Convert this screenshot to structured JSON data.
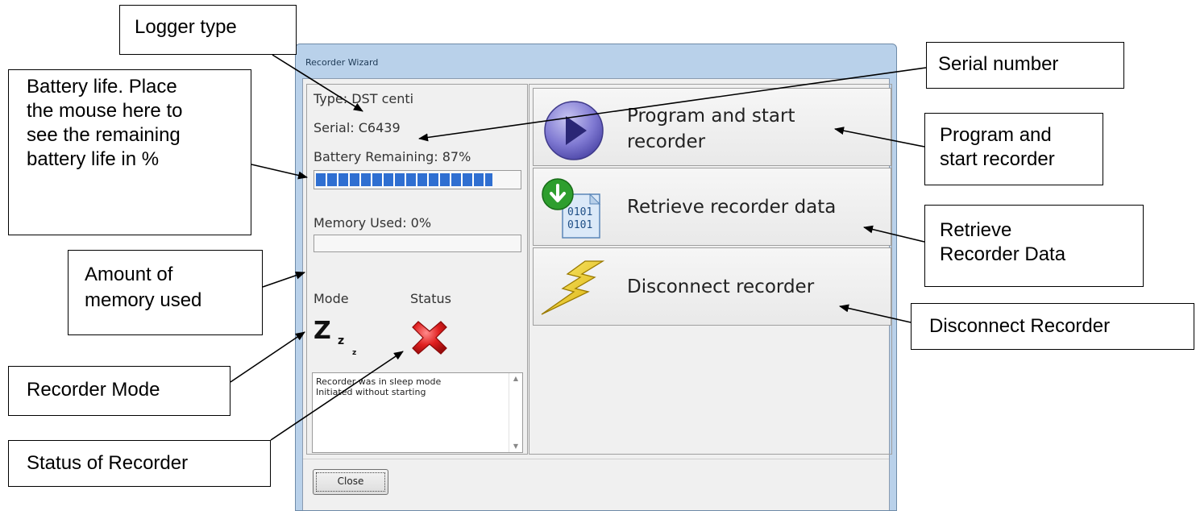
{
  "window": {
    "title": "Recorder Wizard",
    "close_button_label": "Close"
  },
  "info": {
    "type_text": "Type: DST centi",
    "serial_text": "Serial: C6439",
    "battery_text": "Battery Remaining: 87%",
    "battery_fraction": 0.87,
    "memory_text": "Memory Used: 0%",
    "memory_fraction": 0.0,
    "mode_label": "Mode",
    "status_label": "Status",
    "mode_icon": "sleep-zzz-icon",
    "status_icon": "red-x-icon"
  },
  "log": {
    "lines": [
      "Recorder was in sleep mode",
      "Initiated without starting"
    ]
  },
  "actions": {
    "program_label_1": "Program and start",
    "program_label_2": "recorder",
    "retrieve_label": "Retrieve recorder data",
    "disconnect_label": "Disconnect recorder",
    "retrieve_icon_text_1": "0101",
    "retrieve_icon_text_2": "0101"
  },
  "callouts": {
    "logger_type": "Logger type",
    "serial_number": "Serial number",
    "battery_1": "Battery life. Place",
    "battery_2": "the mouse here to",
    "battery_3": "see the remaining",
    "battery_4": "battery life in %",
    "program_1": "Program and",
    "program_2": "start recorder",
    "memory_1": "Amount of",
    "memory_2": "memory used",
    "retrieve_1": "Retrieve",
    "retrieve_2": "Recorder Data",
    "mode": "Recorder Mode",
    "disconnect": "Disconnect Recorder",
    "status": "Status of Recorder"
  },
  "colors": {
    "battery_bar": "#2f6fd1",
    "window_frame": "#b9d1ea",
    "status_x": "#e02020"
  }
}
